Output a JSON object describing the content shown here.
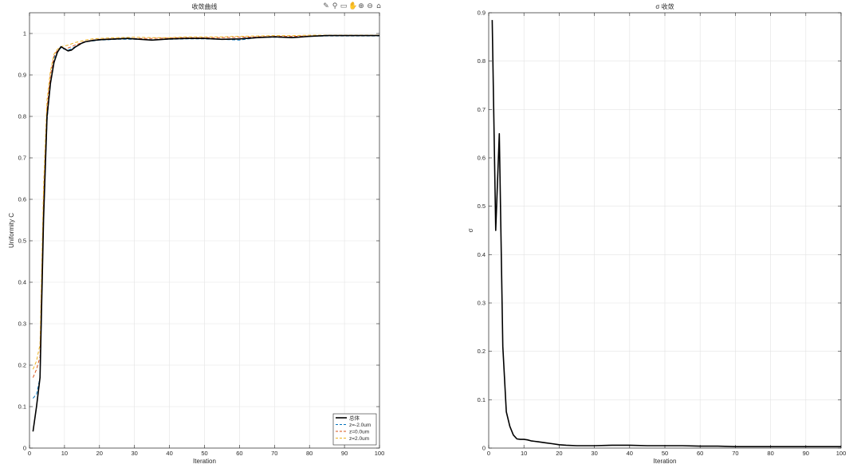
{
  "toolbar": {
    "icons": [
      "export-icon",
      "brush-icon",
      "data-tip-icon",
      "pan-icon",
      "zoom-in-icon",
      "zoom-out-icon",
      "home-icon"
    ],
    "glyphs": [
      "✎",
      "⚲",
      "▭",
      "✋",
      "⊕",
      "⊖",
      "⌂"
    ]
  },
  "chart_data": [
    {
      "type": "line",
      "title": "收敛曲线",
      "xlabel": "Iteration",
      "ylabel": "Uniformity C",
      "xlim": [
        0,
        100
      ],
      "ylim": [
        0,
        1.05
      ],
      "xticks": [
        0,
        10,
        20,
        30,
        40,
        50,
        60,
        70,
        80,
        90,
        100
      ],
      "yticks": [
        0,
        0.1,
        0.2,
        0.3,
        0.4,
        0.5,
        0.6,
        0.7,
        0.8,
        0.9,
        1
      ],
      "grid": true,
      "legend_position": "bottom-right",
      "series": [
        {
          "name": "总体",
          "color": "#000000",
          "dash": "solid",
          "x": [
            1,
            2,
            3,
            4,
            5,
            6,
            7,
            8,
            9,
            10,
            11,
            12,
            13,
            14,
            15,
            16,
            18,
            20,
            25,
            28,
            30,
            35,
            40,
            45,
            50,
            55,
            60,
            65,
            70,
            75,
            80,
            85,
            90,
            95,
            100
          ],
          "y": [
            0.04,
            0.1,
            0.17,
            0.55,
            0.8,
            0.88,
            0.93,
            0.955,
            0.968,
            0.963,
            0.958,
            0.96,
            0.967,
            0.972,
            0.977,
            0.98,
            0.983,
            0.985,
            0.987,
            0.988,
            0.987,
            0.984,
            0.987,
            0.988,
            0.988,
            0.986,
            0.987,
            0.99,
            0.992,
            0.99,
            0.993,
            0.995,
            0.995,
            0.995,
            0.995
          ]
        },
        {
          "name": "z=-2.0um",
          "color": "#0072BD",
          "dash": "dashed",
          "x": [
            1,
            2,
            3,
            4,
            5,
            6,
            7,
            8,
            9,
            10,
            11,
            12,
            13,
            14,
            15,
            16,
            18,
            20,
            25,
            30,
            35,
            40,
            45,
            50,
            55,
            60,
            65,
            70,
            75,
            80,
            85,
            90,
            95,
            100
          ],
          "y": [
            0.12,
            0.13,
            0.17,
            0.55,
            0.79,
            0.88,
            0.94,
            0.96,
            0.965,
            0.962,
            0.96,
            0.963,
            0.968,
            0.972,
            0.976,
            0.98,
            0.982,
            0.984,
            0.986,
            0.986,
            0.985,
            0.986,
            0.987,
            0.987,
            0.986,
            0.984,
            0.99,
            0.991,
            0.991,
            0.993,
            0.994,
            0.994,
            0.994,
            0.994
          ]
        },
        {
          "name": "z=0.0um",
          "color": "#D95319",
          "dash": "dashed",
          "x": [
            1,
            2,
            3,
            4,
            5,
            6,
            7,
            8,
            9,
            10,
            11,
            12,
            13,
            14,
            15,
            16,
            18,
            20,
            25,
            30,
            35,
            40,
            45,
            50,
            55,
            60,
            65,
            70,
            75,
            80,
            85,
            90,
            95,
            100
          ],
          "y": [
            0.17,
            0.19,
            0.22,
            0.6,
            0.82,
            0.9,
            0.945,
            0.96,
            0.967,
            0.963,
            0.965,
            0.968,
            0.972,
            0.975,
            0.978,
            0.981,
            0.984,
            0.986,
            0.988,
            0.988,
            0.988,
            0.989,
            0.99,
            0.99,
            0.99,
            0.991,
            0.992,
            0.993,
            0.993,
            0.994,
            0.995,
            0.995,
            0.995,
            0.995
          ]
        },
        {
          "name": "z=2.0um",
          "color": "#EDB120",
          "dash": "dashed",
          "x": [
            1,
            2,
            3,
            4,
            5,
            6,
            7,
            8,
            9,
            10,
            11,
            12,
            13,
            14,
            15,
            16,
            18,
            20,
            25,
            30,
            35,
            40,
            45,
            50,
            55,
            60,
            65,
            70,
            75,
            80,
            85,
            90,
            95,
            100
          ],
          "y": [
            0.19,
            0.21,
            0.25,
            0.63,
            0.84,
            0.91,
            0.95,
            0.962,
            0.968,
            0.97,
            0.972,
            0.975,
            0.978,
            0.98,
            0.982,
            0.984,
            0.987,
            0.988,
            0.99,
            0.991,
            0.99,
            0.99,
            0.992,
            0.992,
            0.992,
            0.993,
            0.994,
            0.995,
            0.995,
            0.996,
            0.996,
            0.996,
            0.996,
            0.996
          ]
        }
      ]
    },
    {
      "type": "line",
      "title": "σ 收敛",
      "xlabel": "Iteration",
      "ylabel": "σ",
      "xlim": [
        0,
        100
      ],
      "ylim": [
        0,
        0.9
      ],
      "xticks": [
        0,
        10,
        20,
        30,
        40,
        50,
        60,
        70,
        80,
        90,
        100
      ],
      "yticks": [
        0,
        0.1,
        0.2,
        0.3,
        0.4,
        0.5,
        0.6,
        0.7,
        0.8,
        0.9
      ],
      "grid": true,
      "series": [
        {
          "color": "#000000",
          "dash": "solid",
          "x": [
            1,
            2,
            3,
            4,
            5,
            6,
            7,
            8,
            9,
            10,
            11,
            12,
            13,
            14,
            15,
            16,
            18,
            20,
            22,
            25,
            30,
            35,
            40,
            45,
            50,
            55,
            60,
            65,
            70,
            75,
            80,
            85,
            90,
            95,
            100
          ],
          "y": [
            0.885,
            0.45,
            0.65,
            0.21,
            0.075,
            0.045,
            0.027,
            0.019,
            0.018,
            0.018,
            0.017,
            0.015,
            0.014,
            0.013,
            0.012,
            0.011,
            0.009,
            0.007,
            0.006,
            0.005,
            0.005,
            0.006,
            0.006,
            0.005,
            0.005,
            0.005,
            0.004,
            0.004,
            0.003,
            0.003,
            0.003,
            0.003,
            0.003,
            0.003,
            0.003
          ]
        }
      ]
    }
  ]
}
